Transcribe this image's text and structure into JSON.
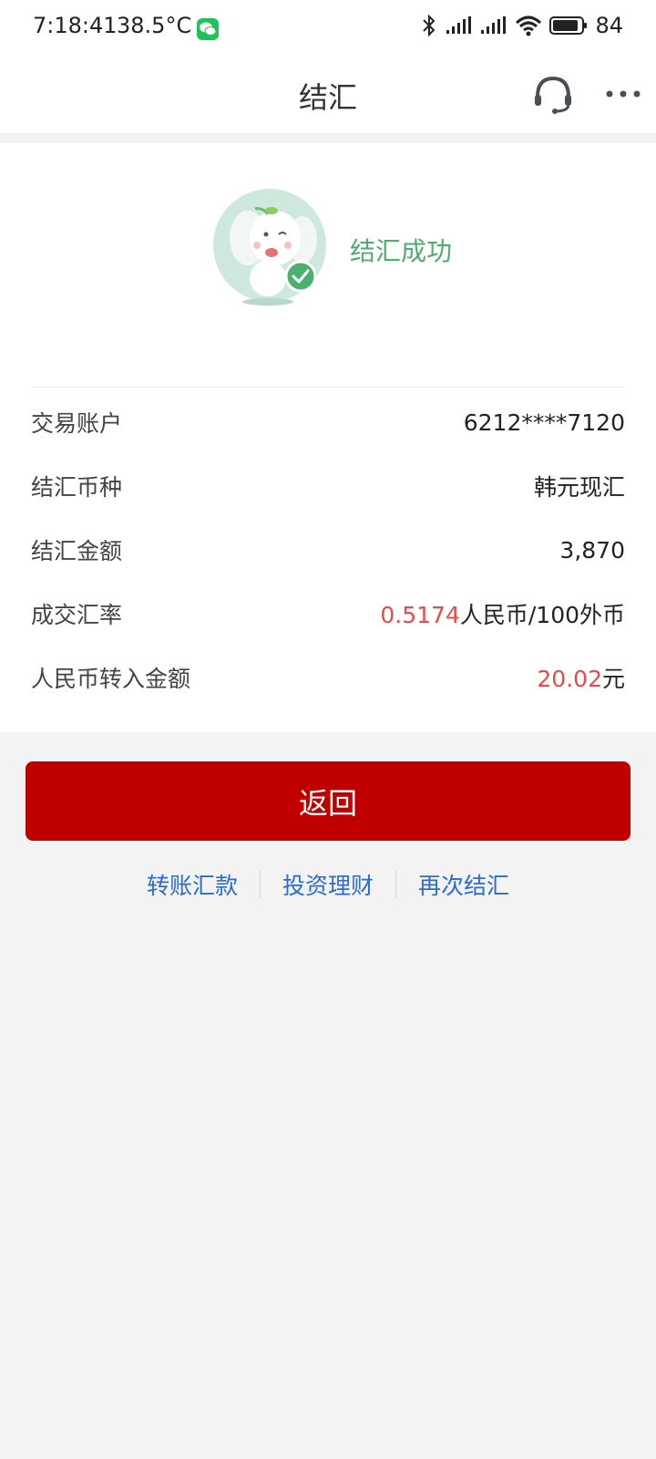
{
  "status_bar": {
    "time": "7:18:41",
    "temperature": "38.5°C",
    "battery": "84"
  },
  "header": {
    "title": "结汇"
  },
  "result": {
    "status_text": "结汇成功",
    "status_color": "#4caf6e"
  },
  "details": {
    "account": {
      "label": "交易账户",
      "value": "6212****7120"
    },
    "currency": {
      "label": "结汇币种",
      "value": "韩元现汇"
    },
    "amount": {
      "label": "结汇金额",
      "value": "3,870"
    },
    "rate": {
      "label": "成交汇率",
      "value_number": "0.5174",
      "value_unit": "人民币/100外币"
    },
    "rmb_amount": {
      "label": "人民币转入金额",
      "value_number": "20.02",
      "value_unit": "元"
    }
  },
  "actions": {
    "return_label": "返回",
    "links": [
      "转账汇款",
      "投资理财",
      "再次结汇"
    ]
  },
  "colors": {
    "primary_red": "#c00000",
    "highlight_red": "#e74c4c",
    "link_blue": "#2e6bd1"
  },
  "icons": [
    "wechat-icon",
    "bluetooth-icon",
    "signal-icon",
    "wifi-icon",
    "battery-icon",
    "headset-icon",
    "more-icon",
    "elephant-mascot-icon",
    "check-icon"
  ]
}
